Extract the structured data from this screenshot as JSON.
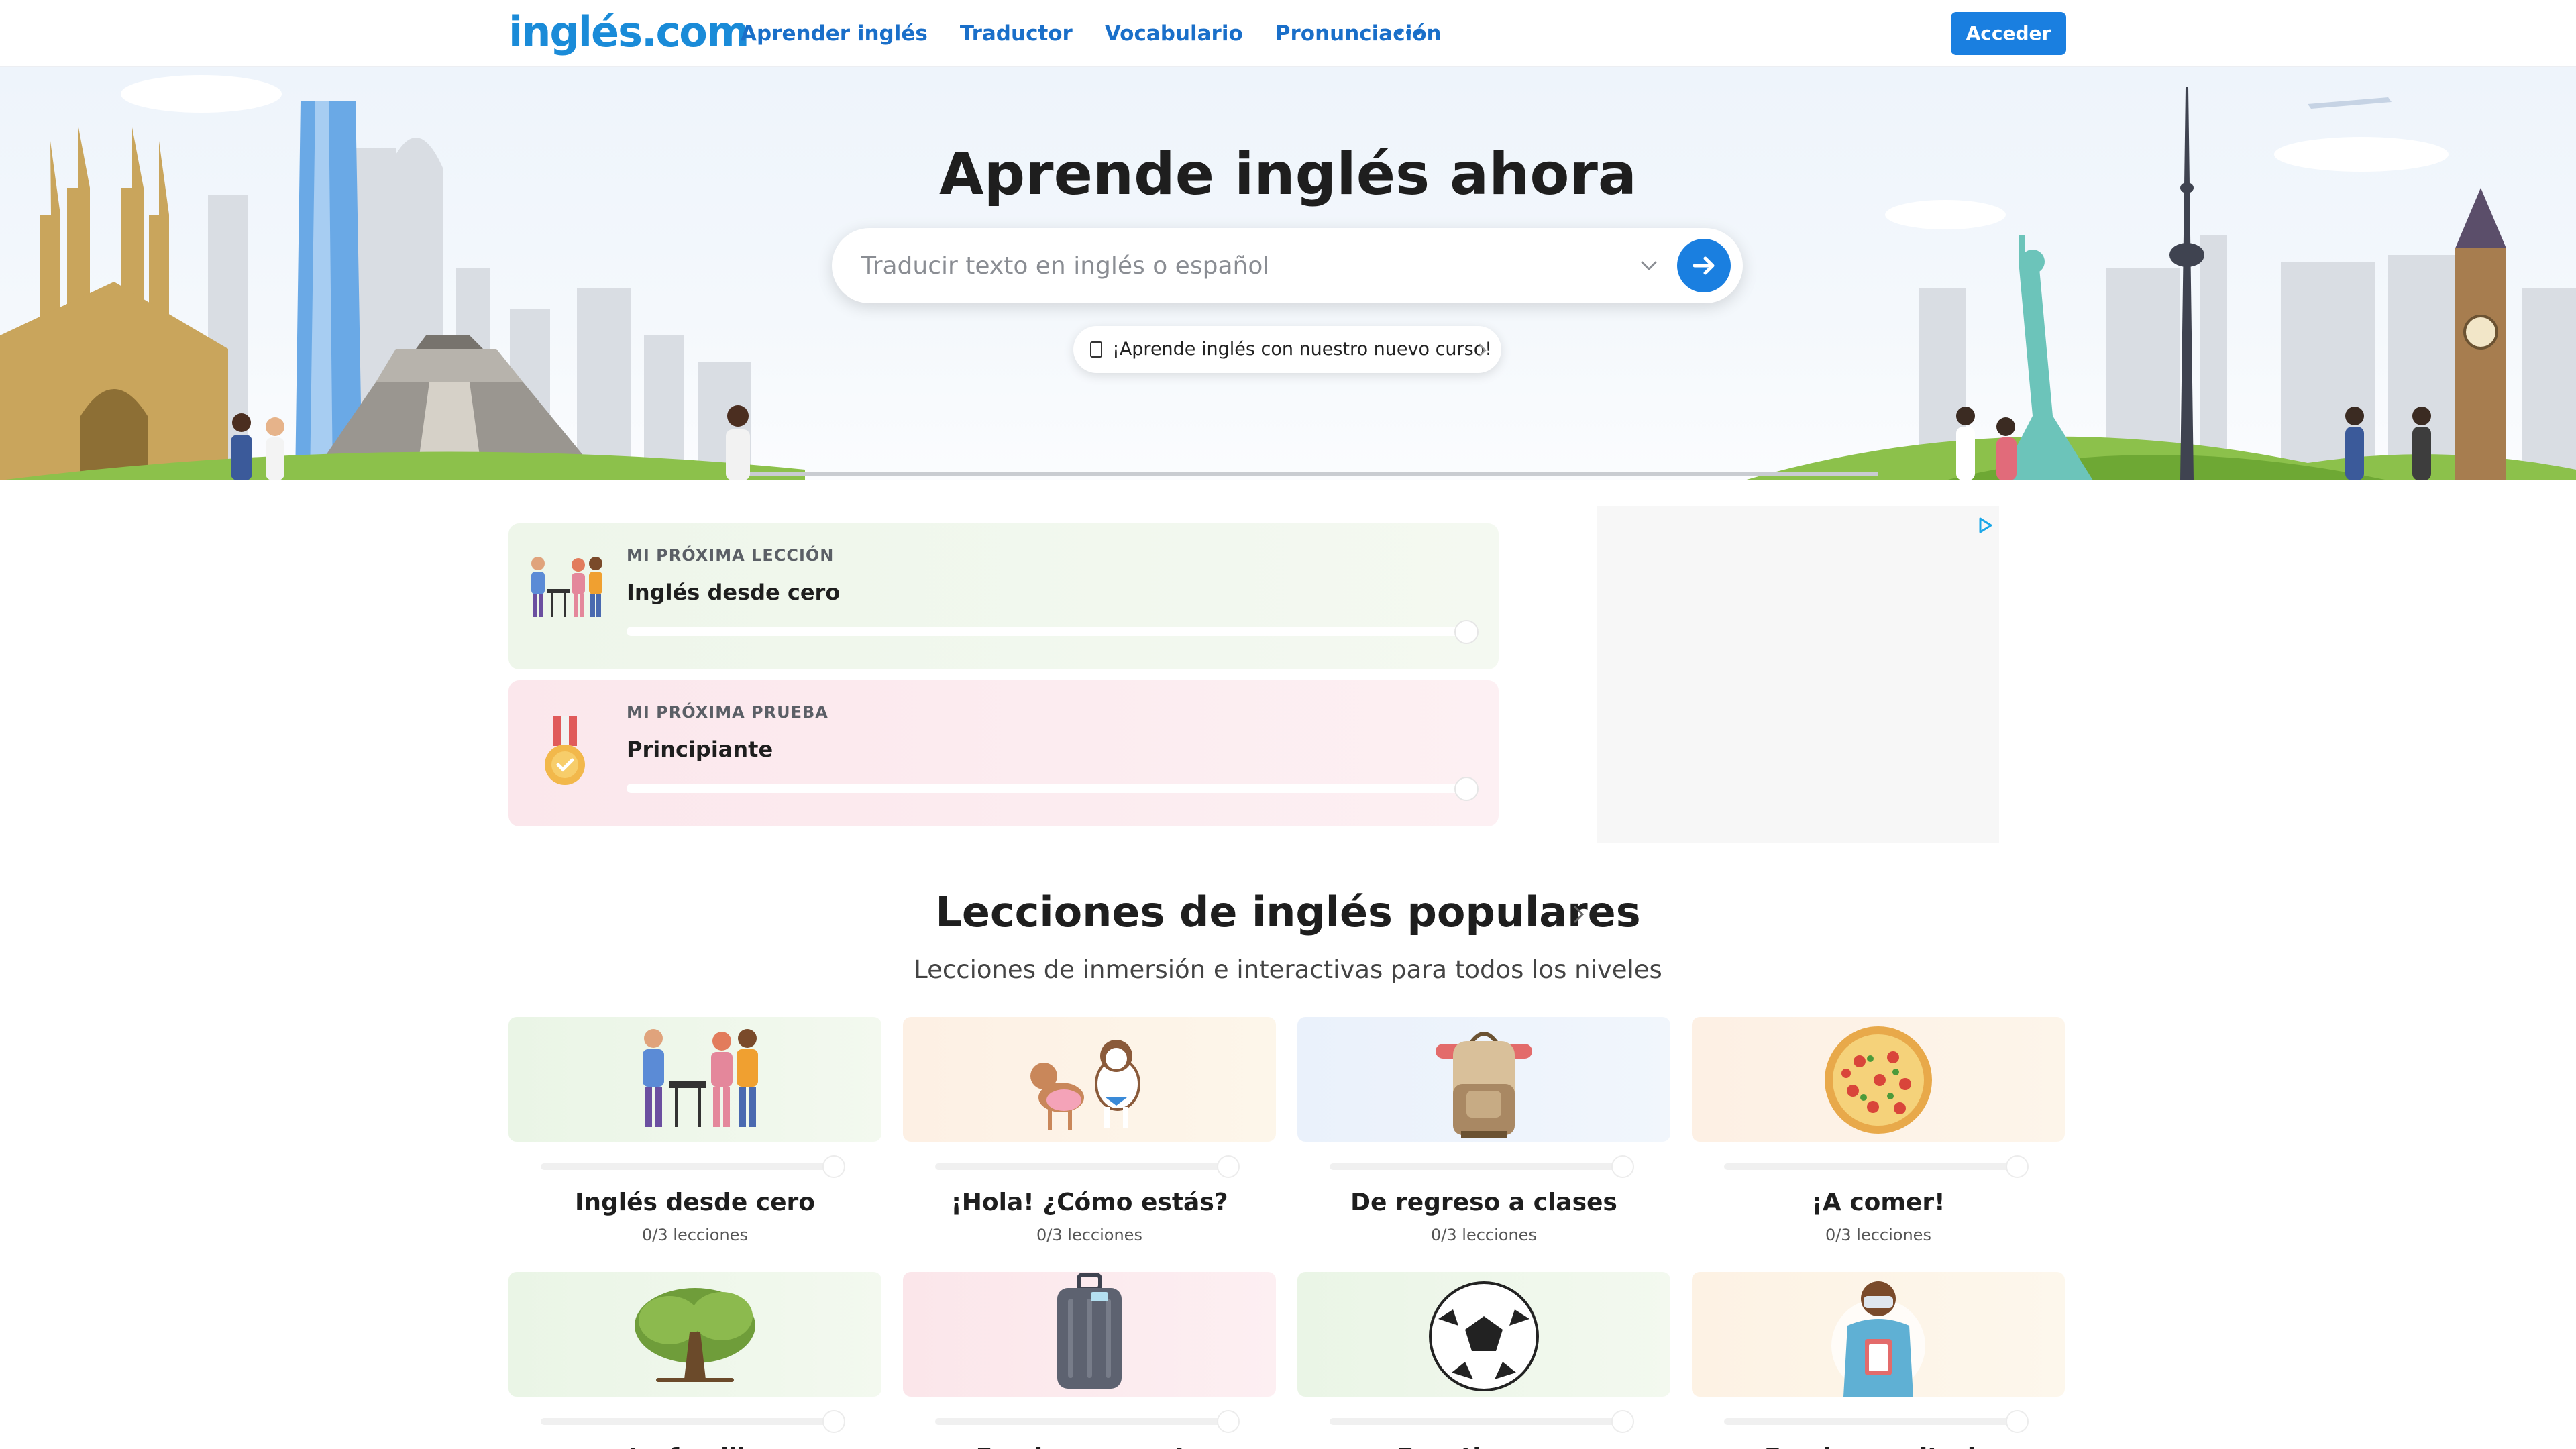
{
  "header": {
    "logo": "inglés.com",
    "nav": [
      "Aprender inglés",
      "Traductor",
      "Vocabulario",
      "Pronunciación"
    ],
    "login_label": "Acceder"
  },
  "hero": {
    "title": "Aprende inglés ahora",
    "search_placeholder": "Traducir texto en inglés o español",
    "course_pill": "¡Aprende inglés con nuestro nuevo curso!"
  },
  "next_lesson": {
    "kicker": "MI PRÓXIMA LECCIÓN",
    "title": "Inglés desde cero",
    "progress": 0
  },
  "next_test": {
    "kicker": "MI PRÓXIMA PRUEBA",
    "title": "Principiante",
    "progress": 0
  },
  "popular": {
    "title": "Lecciones de inglés populares",
    "subtitle": "Lecciones de inmersión e interactivas para todos los niveles",
    "lessons": [
      {
        "title": "Inglés desde cero",
        "count": "0/3 lecciones",
        "icon": "people-bbq-illustration"
      },
      {
        "title": "¡Hola! ¿Cómo estás?",
        "count": "0/3 lecciones",
        "icon": "dogs-illustration"
      },
      {
        "title": "De regreso a clases",
        "count": "0/3 lecciones",
        "icon": "backpack-illustration"
      },
      {
        "title": "¡A comer!",
        "count": "0/3 lecciones",
        "icon": "pizza-illustration"
      },
      {
        "title": "La familia",
        "count": "",
        "icon": "tree-illustration"
      },
      {
        "title": "En el aeropuerto",
        "count": "",
        "icon": "suitcase-illustration"
      },
      {
        "title": "Pasatiempos",
        "count": "",
        "icon": "soccer-ball-illustration"
      },
      {
        "title": "En el consultorio",
        "count": "",
        "icon": "doctor-illustration"
      }
    ]
  },
  "colors": {
    "brand": "#1a8bd8",
    "nav": "#1a6fc9",
    "button": "#1a7fe0"
  }
}
